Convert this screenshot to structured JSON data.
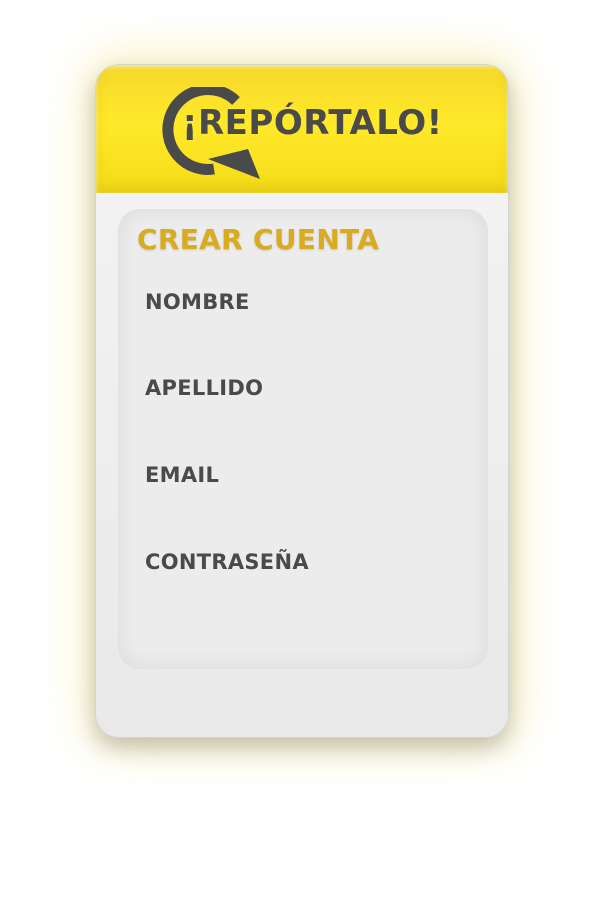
{
  "header": {
    "brand": "¡REPÓRTALO!",
    "logo_icon": "speech-bubble-icon",
    "colors": {
      "header_yellow": "#ffe92a",
      "logo_gray": "#4a4a4a"
    }
  },
  "form": {
    "title": "CREAR CUENTA",
    "title_color": "#d9ab20",
    "fields": [
      {
        "label": "NOMBRE"
      },
      {
        "label": "APELLIDO"
      },
      {
        "label": "EMAIL"
      },
      {
        "label": "CONTRASEÑA"
      }
    ]
  }
}
